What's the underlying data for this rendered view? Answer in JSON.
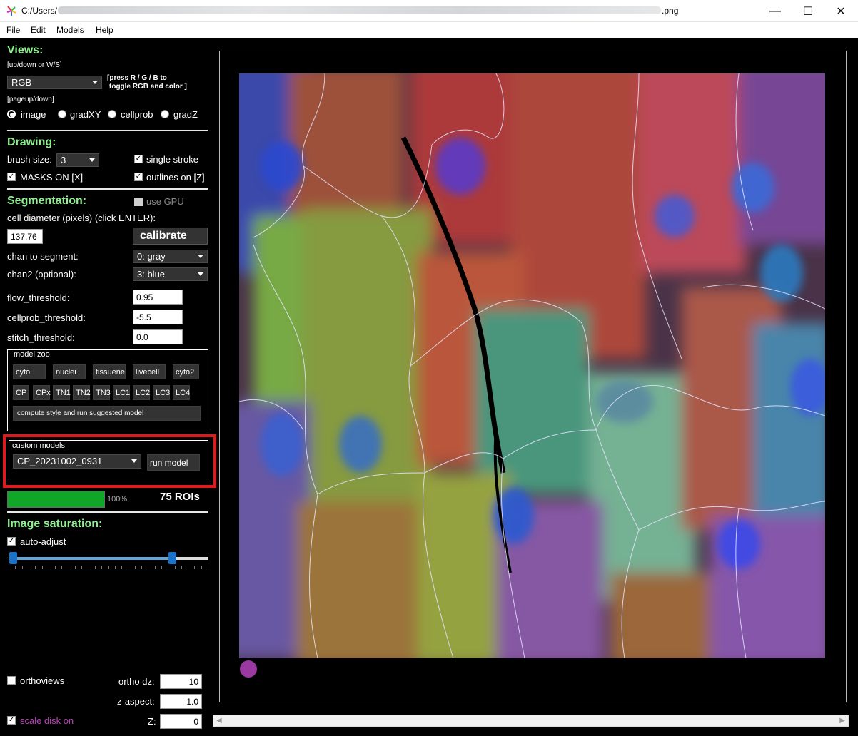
{
  "window": {
    "title_prefix": "C:/Users/",
    "title_suffix": ".png",
    "minimize_label": "—",
    "maximize_label": "☐",
    "close_label": "✕"
  },
  "menu": [
    "File",
    "Edit",
    "Models",
    "Help"
  ],
  "views": {
    "heading": "Views:",
    "hint_updown": "[up/down or W/S]",
    "view_mode": "RGB",
    "hint_rgb_1": "[press R / G / B to",
    "hint_rgb_2": "toggle RGB and color ]",
    "hint_pageupdown": "[pageup/down]",
    "radios": [
      {
        "label": "image",
        "selected": true
      },
      {
        "label": "gradXY",
        "selected": false
      },
      {
        "label": "cellprob",
        "selected": false
      },
      {
        "label": "gradZ",
        "selected": false
      }
    ]
  },
  "drawing": {
    "heading": "Drawing:",
    "brush_label": "brush size:",
    "brush_value": "3",
    "single_stroke": "single stroke",
    "masks_on": "MASKS ON [X]",
    "outlines_on": "outlines on [Z]"
  },
  "segmentation": {
    "heading": "Segmentation:",
    "use_gpu": "use GPU",
    "diameter_label": "cell diameter (pixels) (click ENTER):",
    "diameter_value": "137.76",
    "calibrate": "calibrate",
    "chan_label": "chan to segment:",
    "chan_value": "0: gray",
    "chan2_label": "chan2 (optional):",
    "chan2_value": "3: blue",
    "flow_label": "flow_threshold:",
    "flow_value": "0.95",
    "cellprob_label": "cellprob_threshold:",
    "cellprob_value": "-5.5",
    "stitch_label": "stitch_threshold:",
    "stitch_value": "0.0"
  },
  "model_zoo": {
    "title": "model zoo",
    "row1": [
      "cyto",
      "nuclei",
      "tissuenet",
      "livecell",
      "cyto2"
    ],
    "row2": [
      "CP",
      "CPx",
      "TN1",
      "TN2",
      "TN3",
      "LC1",
      "LC2",
      "LC3",
      "LC4"
    ],
    "suggest": "compute style and run suggested model"
  },
  "custom_models": {
    "title": "custom models",
    "selected": "CP_20231002_0931",
    "run": "run model"
  },
  "progress": {
    "value": 100,
    "label": "100%",
    "rois": "75 ROIs"
  },
  "saturation": {
    "heading": "Image saturation:",
    "auto_adjust": "auto-adjust",
    "low": 0.03,
    "high": 0.82
  },
  "bottom": {
    "orthoviews": "orthoviews",
    "ortho_dz_label": "ortho dz:",
    "ortho_dz": "10",
    "z_aspect_label": "z-aspect:",
    "z_aspect": "1.0",
    "z_label": "Z:",
    "z_value": "0",
    "scale_disk": "scale disk on"
  },
  "colors": {
    "heading_green": "#8ef08e",
    "progress_green": "#10a628",
    "highlight_red": "#e0191e",
    "scale_disk_purple": "#9a3aa0",
    "slider_blue": "#1a73c8"
  }
}
